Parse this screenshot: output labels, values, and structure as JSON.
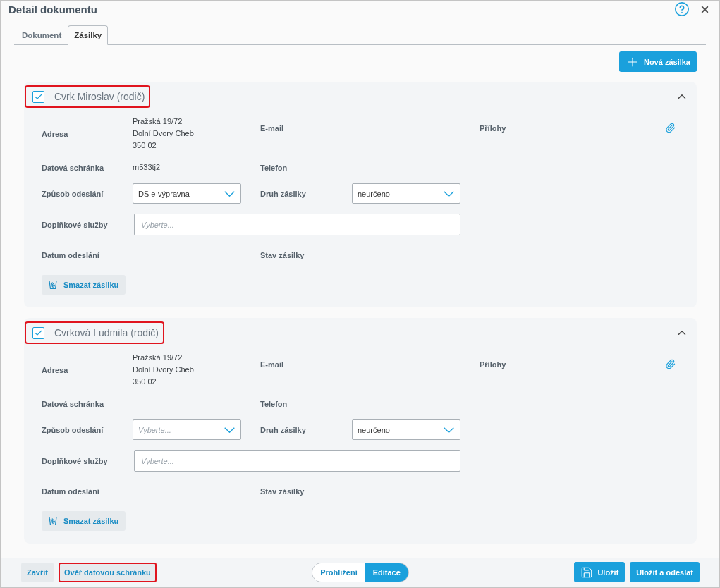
{
  "window": {
    "title": "Detail dokumentu"
  },
  "tabs": [
    {
      "label": "Dokument",
      "selected": false
    },
    {
      "label": "Zásilky",
      "selected": true
    }
  ],
  "new_button": {
    "label": "Nová zásilka"
  },
  "shipments": [
    {
      "recipient": "Cvrk Miroslav (rodič)",
      "checked": true,
      "highlighted": true,
      "expanded": true,
      "address_label": "Adresa",
      "address": [
        "Pražská 19/72",
        "Dolní Dvory Cheb",
        "350 02"
      ],
      "email_label": "E-mail",
      "attachments_label": "Přílohy",
      "databox_label": "Datová schránka",
      "databox": "m533tj2",
      "phone_label": "Telefon",
      "method_label": "Způsob odeslání",
      "method": {
        "value": "DS e-výpravna"
      },
      "type_label": "Druh zásilky",
      "type": {
        "value": "neurčeno"
      },
      "services_label": "Doplňkové služby",
      "services": {
        "placeholder": "Vyberte..."
      },
      "date_label": "Datum odeslání",
      "state_label": "Stav zásilky",
      "delete_label": "Smazat zásilku"
    },
    {
      "recipient": "Cvrková Ludmila (rodič)",
      "checked": true,
      "highlighted": true,
      "expanded": true,
      "address_label": "Adresa",
      "address": [
        "Pražská 19/72",
        "Dolní Dvory Cheb",
        "350 02"
      ],
      "email_label": "E-mail",
      "attachments_label": "Přílohy",
      "databox_label": "Datová schránka",
      "phone_label": "Telefon",
      "method_label": "Způsob odeslání",
      "method": {
        "placeholder": "Vyberte..."
      },
      "type_label": "Druh zásilky",
      "type": {
        "value": "neurčeno"
      },
      "services_label": "Doplňkové služby",
      "services": {
        "placeholder": "Vyberte..."
      },
      "date_label": "Datum odeslání",
      "state_label": "Stav zásilky",
      "delete_label": "Smazat zásilku"
    }
  ],
  "footer": {
    "close": "Zavřít",
    "verify": {
      "label": "Ověř datovou schránku",
      "highlighted": true
    },
    "mode": [
      {
        "label": "Prohlížení",
        "selected": false
      },
      {
        "label": "Editace",
        "selected": true
      }
    ],
    "save": "Uložit",
    "save_send": "Uložit a odeslat"
  }
}
